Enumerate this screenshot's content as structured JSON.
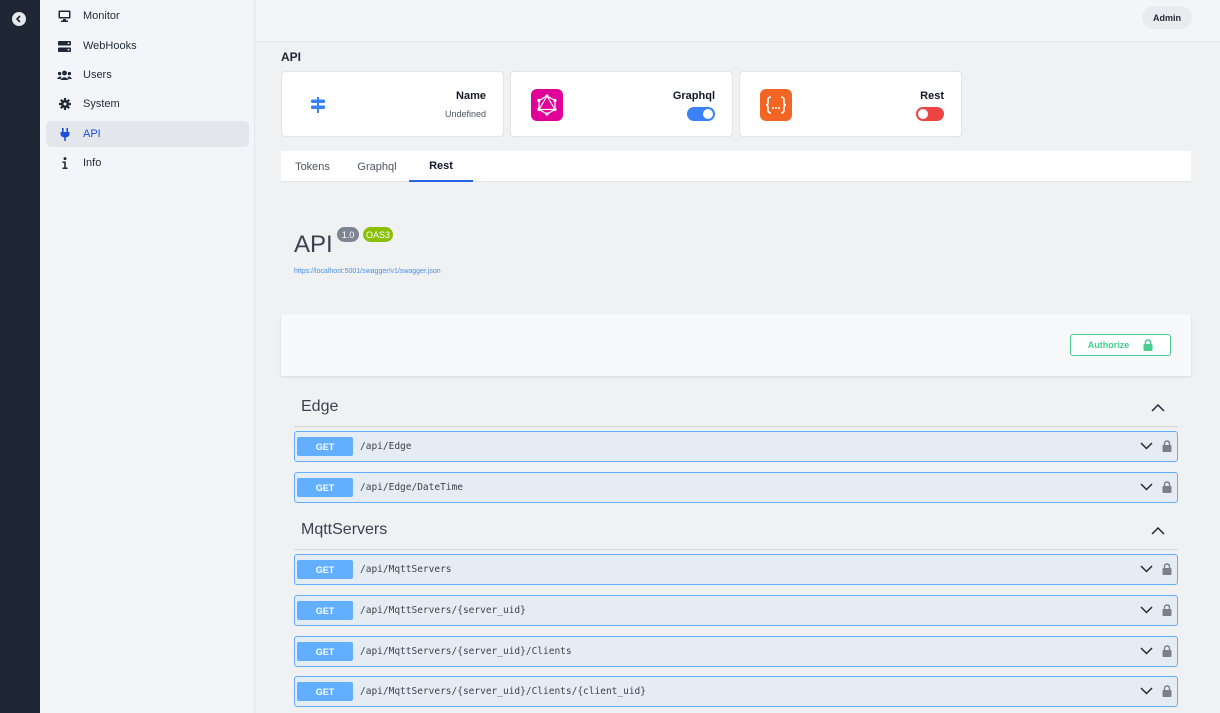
{
  "header": {
    "admin_label": "Admin"
  },
  "sidebar": {
    "items": [
      {
        "label": "Monitor",
        "icon": "monitor-icon"
      },
      {
        "label": "WebHooks",
        "icon": "server-icon"
      },
      {
        "label": "Users",
        "icon": "users-icon"
      },
      {
        "label": "System",
        "icon": "gear-icon"
      },
      {
        "label": "API",
        "icon": "plug-icon",
        "active": true
      },
      {
        "label": "Info",
        "icon": "info-icon"
      }
    ]
  },
  "page": {
    "title": "API"
  },
  "cards": {
    "name": {
      "label": "Name",
      "value": "Undefined",
      "icon": "signpost-icon"
    },
    "graphql": {
      "label": "Graphql",
      "enabled": true,
      "icon": "graphql-icon",
      "color": "#e10098"
    },
    "rest": {
      "label": "Rest",
      "enabled": false,
      "icon": "rest-braces-icon",
      "color": "#f26522"
    }
  },
  "tabs": [
    "Tokens",
    "Graphql",
    "Rest"
  ],
  "active_tab": "Rest",
  "swagger": {
    "title": "API",
    "version": "1.0",
    "oas": "OAS3",
    "url": "https://localhost:5001/swagger/v1/swagger.json",
    "authorize_label": "Authorize"
  },
  "sections": [
    {
      "name": "Edge",
      "operations": [
        {
          "method": "GET",
          "path": "/api/Edge"
        },
        {
          "method": "GET",
          "path": "/api/Edge/DateTime"
        }
      ]
    },
    {
      "name": "MqttServers",
      "operations": [
        {
          "method": "GET",
          "path": "/api/MqttServers"
        },
        {
          "method": "GET",
          "path": "/api/MqttServers/{server_uid}"
        },
        {
          "method": "GET",
          "path": "/api/MqttServers/{server_uid}/Clients"
        },
        {
          "method": "GET",
          "path": "/api/MqttServers/{server_uid}/Clients/{client_uid}"
        }
      ]
    }
  ],
  "colors": {
    "get": "#61affe",
    "authorize": "#49cc90",
    "toggle_on": "#3b82f6",
    "toggle_off": "#ef4444"
  }
}
